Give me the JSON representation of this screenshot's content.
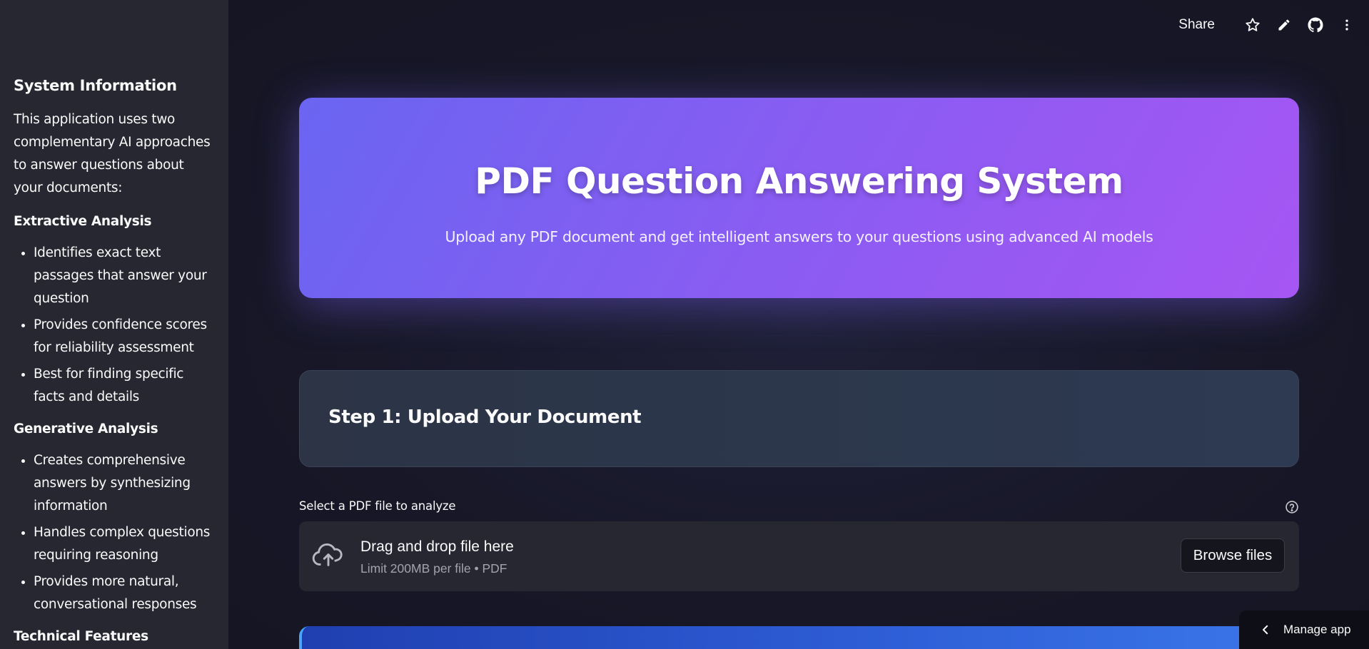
{
  "sidebar": {
    "title": "System Information",
    "intro": "This application uses two complementary AI approaches to answer questions about your documents:",
    "sections": [
      {
        "heading": "Extractive Analysis",
        "items": [
          "Identifies exact text passages that answer your question",
          "Provides confidence scores for reliability assessment",
          "Best for finding specific facts and details"
        ]
      },
      {
        "heading": "Generative Analysis",
        "items": [
          "Creates comprehensive answers by synthesizing information",
          "Handles complex questions requiring reasoning",
          "Provides more natural, conversational responses"
        ]
      },
      {
        "heading": "Technical Features",
        "items": []
      }
    ]
  },
  "toolbar": {
    "share_label": "Share",
    "icons": [
      "star-icon",
      "pencil-icon",
      "github-icon",
      "more-vertical-icon"
    ]
  },
  "hero": {
    "title": "PDF Question Answering System",
    "subtitle": "Upload any PDF document and get intelligent answers to your questions using advanced AI models"
  },
  "step1": {
    "title": "Step 1: Upload Your Document"
  },
  "uploader": {
    "label": "Select a PDF file to analyze",
    "drop_title": "Drag and drop file here",
    "drop_sub": "Limit 200MB per file • PDF",
    "browse_label": "Browse files"
  },
  "manage_app": {
    "label": "Manage app"
  },
  "colors": {
    "hero_gradient_start": "#6a65f2",
    "hero_gradient_end": "#a656f3",
    "sidebar_bg": "#262730",
    "main_bg": "#161625",
    "step_card_bg": "#2d3a52",
    "next_card_accent": "#2f5fd8"
  }
}
